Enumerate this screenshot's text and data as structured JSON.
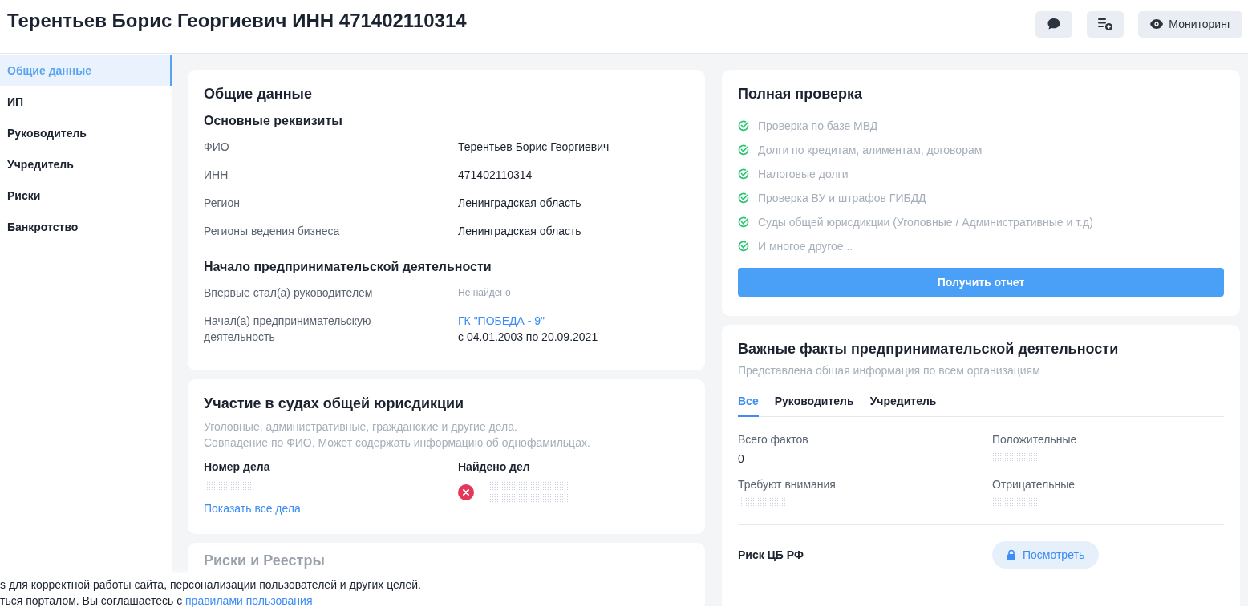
{
  "header": {
    "title": "Терентьев Борис Георгиевич ИНН 471402110314",
    "actions": [
      {
        "kind": "comment"
      },
      {
        "kind": "list-add"
      },
      {
        "kind": "monitor",
        "label": "Мониторинг"
      }
    ]
  },
  "sidebar": {
    "items": [
      {
        "label": "Общие данные",
        "selected": true
      },
      {
        "label": "ИП",
        "selected": false
      },
      {
        "label": "Руководитель",
        "selected": false
      },
      {
        "label": "Учредитель",
        "selected": false
      },
      {
        "label": "Риски",
        "selected": false
      },
      {
        "label": "Банкротство",
        "selected": false
      }
    ]
  },
  "general": {
    "title": "Общие данные",
    "sections": [
      {
        "title": "Основные реквизиты",
        "rows": [
          {
            "kind": "text",
            "label": "ФИО",
            "value": "Терентьев Борис Георгиевич"
          },
          {
            "kind": "text",
            "label": "ИНН",
            "value": "471402110314"
          },
          {
            "kind": "text",
            "label": "Регион",
            "value": "Ленинградская область"
          },
          {
            "kind": "text",
            "label": "Регионы ведения бизнеса",
            "value": "Ленинградская область"
          }
        ]
      },
      {
        "title": "Начало предпринимательской деятельности",
        "rows": [
          {
            "kind": "empty",
            "label": "Впервые стал(а) руководителем",
            "value": "Не найдено"
          },
          {
            "kind": "company",
            "label": "Начал(а) предпринимательскую деятельность",
            "link": "ГК \"ПОБЕДА - 9\"",
            "period": "с 04.01.2003 по 20.09.2021"
          }
        ]
      }
    ]
  },
  "courts": {
    "title": "Участие в судах общей юрисдикции",
    "notes": [
      "Уголовные, административные, гражданские и другие дела.",
      "Совпадение по ФИО. Может содержать информацию об однофамильцах."
    ],
    "case_number_heading": "Номер дела",
    "found_heading": "Найдено дел",
    "show_all_link": "Показать все дела"
  },
  "risks": {
    "title": "Риски и Реестры"
  },
  "full_check": {
    "title": "Полная проверка",
    "items": [
      "Проверка по базе МВД",
      "Долги по кредитам, алиментам, договорам",
      "Налоговые долги",
      "Проверка ВУ и штрафов ГИБДД",
      "Суды общей юрисдикции  (Уголовные / Административные и т.д)",
      "И многое другое..."
    ],
    "button": "Получить отчет"
  },
  "facts": {
    "title": "Важные факты предпринимательской деятельности",
    "subtitle": "Представлена общая информация по всем организациям",
    "tabs": [
      {
        "label": "Все",
        "selected": true
      },
      {
        "label": "Руководитель",
        "selected": false
      },
      {
        "label": "Учредитель",
        "selected": false
      }
    ],
    "stats": [
      {
        "kind": "value",
        "label": "Всего фактов",
        "value": "0"
      },
      {
        "kind": "hidden",
        "label": "Положительные"
      },
      {
        "kind": "hidden",
        "label": "Требуют внимания"
      },
      {
        "kind": "hidden",
        "label": "Отрицательные"
      }
    ],
    "cbr": {
      "label": "Риск ЦБ РФ",
      "button": "Посмотреть"
    }
  },
  "cookie_banner": {
    "line_1": "s для корректной работы сайта, персонализации пользователей и других целей.",
    "line_2": "ться порталом. Вы соглашаетесь с",
    "link": "правилами пользования"
  }
}
